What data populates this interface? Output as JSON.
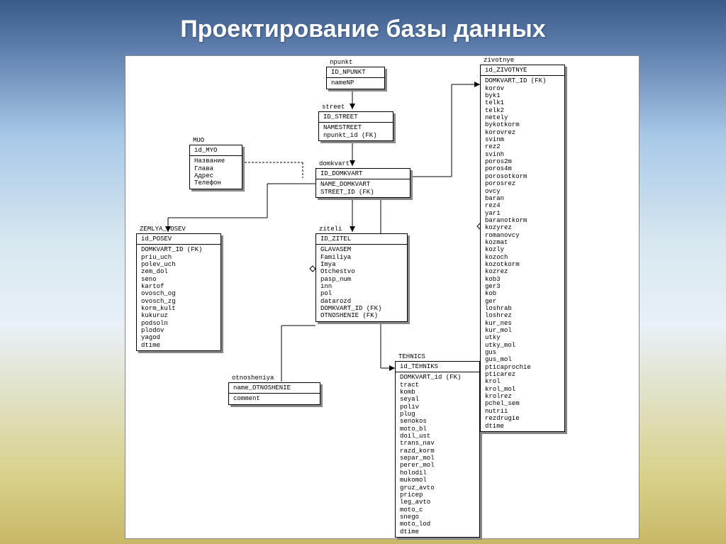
{
  "title": "Проектирование базы данных",
  "entities": {
    "npunkt": {
      "name": "npunkt",
      "pk": [
        "ID_NPUNKT"
      ],
      "attrs": [
        "nameNP"
      ]
    },
    "street": {
      "name": "street",
      "pk": [
        "ID_STREET"
      ],
      "attrs": [
        "NAMESTREET",
        "npunkt_id (FK)"
      ]
    },
    "muo": {
      "name": "MUO",
      "pk": [
        "id_MYO"
      ],
      "attrs": [
        "Название",
        "Глава",
        "Адрес",
        "Телефон"
      ]
    },
    "domkvart": {
      "name": "domkvart",
      "pk": [
        "ID_DOMKVART"
      ],
      "attrs": [
        "NAME_DOMKVART",
        "STREET_ID (FK)"
      ]
    },
    "zemlya_posev": {
      "name": "ZEMLYA_POSEV",
      "pk": [
        "id_POSEV"
      ],
      "attrs": [
        "DOMKVART_ID (FK)",
        "priu_uch",
        "polev_uch",
        "zem_dol",
        "seno",
        "kartof",
        "ovosch_og",
        "ovosch_zg",
        "korm_kult",
        "kukuruz",
        "podsoln",
        "plodov",
        "yagod",
        "dtime"
      ]
    },
    "ziteli": {
      "name": "ziteli",
      "pk": [
        "ID_ZITEL"
      ],
      "attrs": [
        "GLAVASEM",
        "Familiya",
        "Imya",
        "Otchestvo",
        "pasp_num",
        "inn",
        "pol",
        "datarozd",
        "DOMKVART_ID (FK)",
        "OTNOSHENIE (FK)"
      ]
    },
    "otnosheniya": {
      "name": "otnosheniya",
      "pk": [
        "name_OTNOSHENIE"
      ],
      "attrs": [
        "comment"
      ]
    },
    "tehnics": {
      "name": "TEHNICS",
      "pk": [
        "id_TEHNIKS"
      ],
      "attrs": [
        "DOMKVART_id (FK)",
        "tract",
        "komb",
        "seyal",
        "poliv",
        "plug",
        "senokos",
        "moto_bl",
        "doil_ust",
        "trans_nav",
        "razd_korm",
        "separ_mol",
        "perer_mol",
        "holodil",
        "mukomol",
        "gruz_avto",
        "pricep",
        "leg_avto",
        "moto_c",
        "snego",
        "moto_lod",
        "dtime"
      ]
    },
    "zivotnye": {
      "name": "zivotnye",
      "pk": [
        "id_ZIVOTNYE"
      ],
      "attrs": [
        "DOMKVART_ID (FK)",
        "korov",
        "byk1",
        "telk1",
        "telk2",
        "netely",
        "bykotkorm",
        "korovrez",
        "svinm",
        "rez2",
        "svinh",
        "poros2m",
        "poros4m",
        "porosotkorm",
        "porosrez",
        "ovcy",
        "baran",
        "rez4",
        "yar1",
        "baranotkorm",
        "kozyrez",
        "romanovcy",
        "kozmat",
        "kozly",
        "kozoch",
        "kozotkorm",
        "kozrez",
        "kob3",
        "ger3",
        "kob",
        "ger",
        "loshrab",
        "loshrez",
        "kur_nes",
        "kur_mol",
        "utky",
        "utky_mol",
        "gus",
        "gus_mol",
        "pticaprochie",
        "pticarez",
        "krol",
        "krol_mol",
        "krolrez",
        "pchel_sem",
        "nutrii",
        "rezdrugie",
        "dtime"
      ]
    }
  }
}
